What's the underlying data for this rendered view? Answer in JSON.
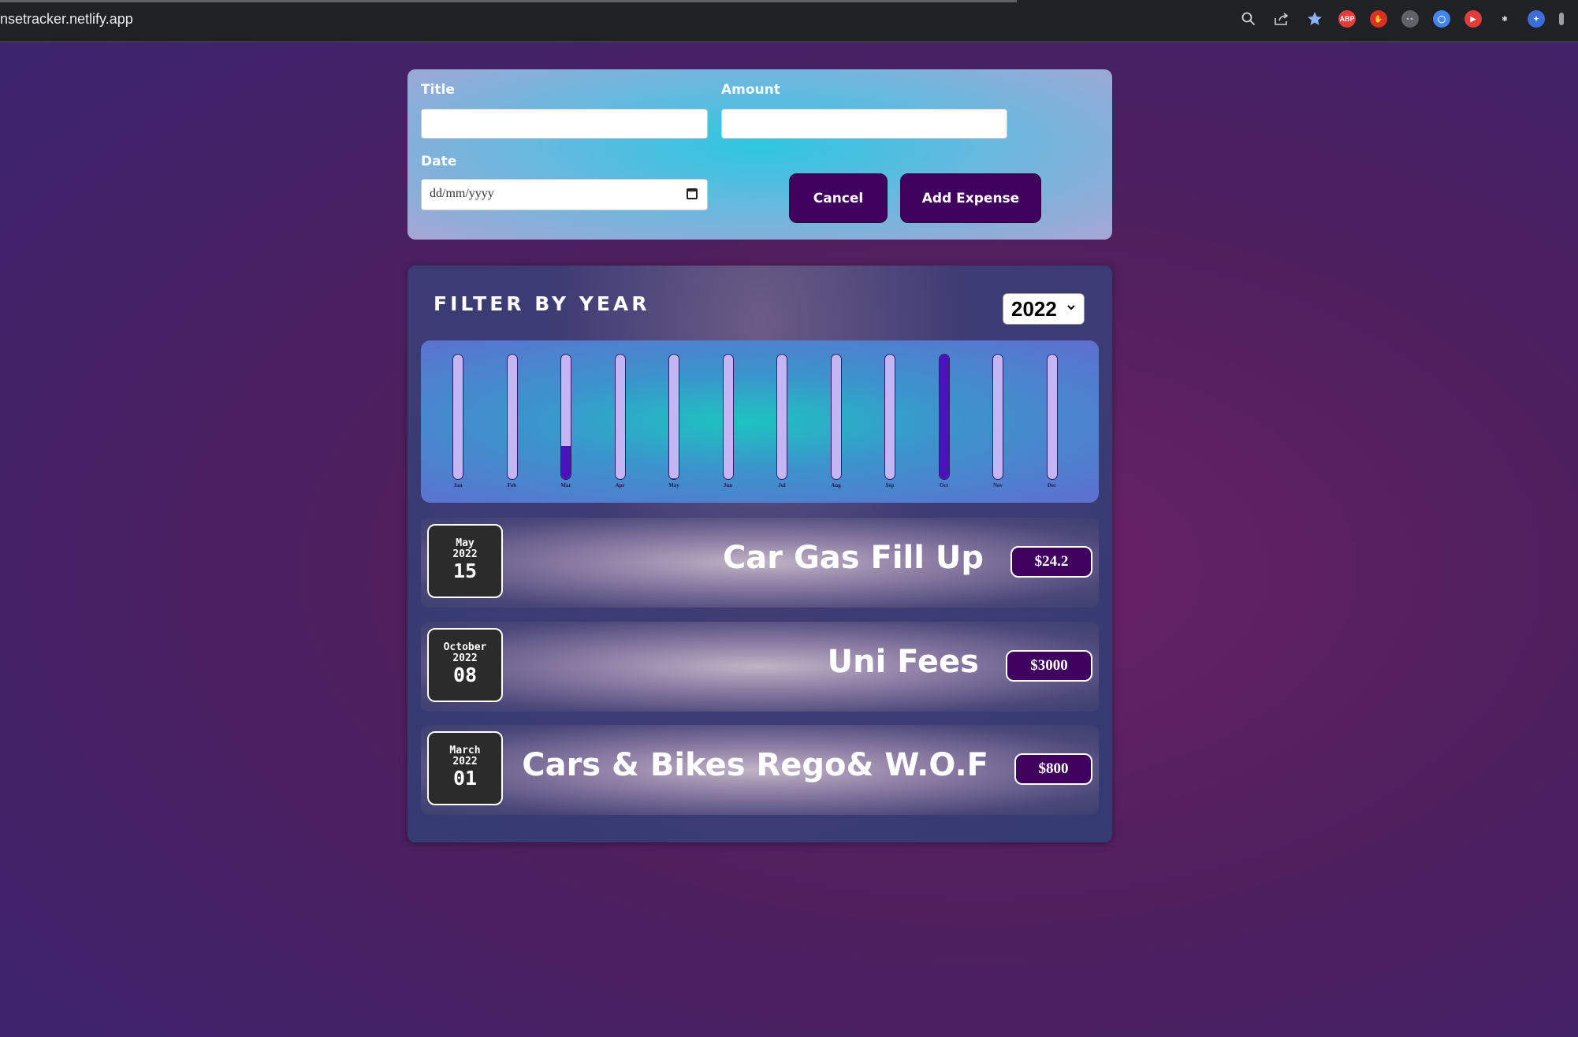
{
  "browser": {
    "url": "nsetracker.netlify.app",
    "icons": [
      "zoom-icon",
      "share-icon",
      "bookmark-star-icon"
    ],
    "extensions": [
      {
        "name": "adblock-plus-extension-icon",
        "label": "ABP",
        "color": "#e23d3d"
      },
      {
        "name": "hand-extension-icon",
        "label": "✋",
        "color": "#d93025"
      },
      {
        "name": "spy-extension-icon",
        "label": "👓",
        "color": "#5f6368"
      },
      {
        "name": "circle-extension-icon",
        "label": "◯",
        "color": "#4285f4"
      },
      {
        "name": "play-extension-icon",
        "label": "▶",
        "color": "#e23d3d"
      },
      {
        "name": "react-devtools-extension-icon",
        "label": "⚛",
        "color": "#202124"
      },
      {
        "name": "colorful-extension-icon",
        "label": "✦",
        "color": "#3c6ed9"
      }
    ]
  },
  "form": {
    "title_label": "Title",
    "amount_label": "Amount",
    "date_label": "Date",
    "title_value": "",
    "amount_value": "",
    "date_placeholder": "dd/mm/yyyy",
    "cancel_label": "Cancel",
    "add_label": "Add Expense"
  },
  "filter": {
    "title": "FILTER BY YEAR",
    "selected_year": "2022"
  },
  "chart_data": {
    "type": "bar",
    "categories": [
      "Jan",
      "Feb",
      "Mar",
      "Apr",
      "May",
      "Jun",
      "Jul",
      "Aug",
      "Sep",
      "Oct",
      "Nov",
      "Dec"
    ],
    "values": [
      0,
      0,
      800,
      0,
      24.2,
      0,
      0,
      0,
      0,
      3000,
      0,
      0
    ],
    "max_value": 3000
  },
  "expenses": [
    {
      "month": "May",
      "year": "2022",
      "day": "15",
      "title": "Car Gas Fill Up",
      "amount": "$24.2"
    },
    {
      "month": "October",
      "year": "2022",
      "day": "08",
      "title": "Uni Fees",
      "amount": "$3000"
    },
    {
      "month": "March",
      "year": "2022",
      "day": "01",
      "title": "Cars & Bikes Rego& W.O.F",
      "amount": "$800"
    }
  ],
  "colors": {
    "accent": "#40005d",
    "bar_empty": "#c4b5f5",
    "bar_fill": "#4a12b8"
  }
}
